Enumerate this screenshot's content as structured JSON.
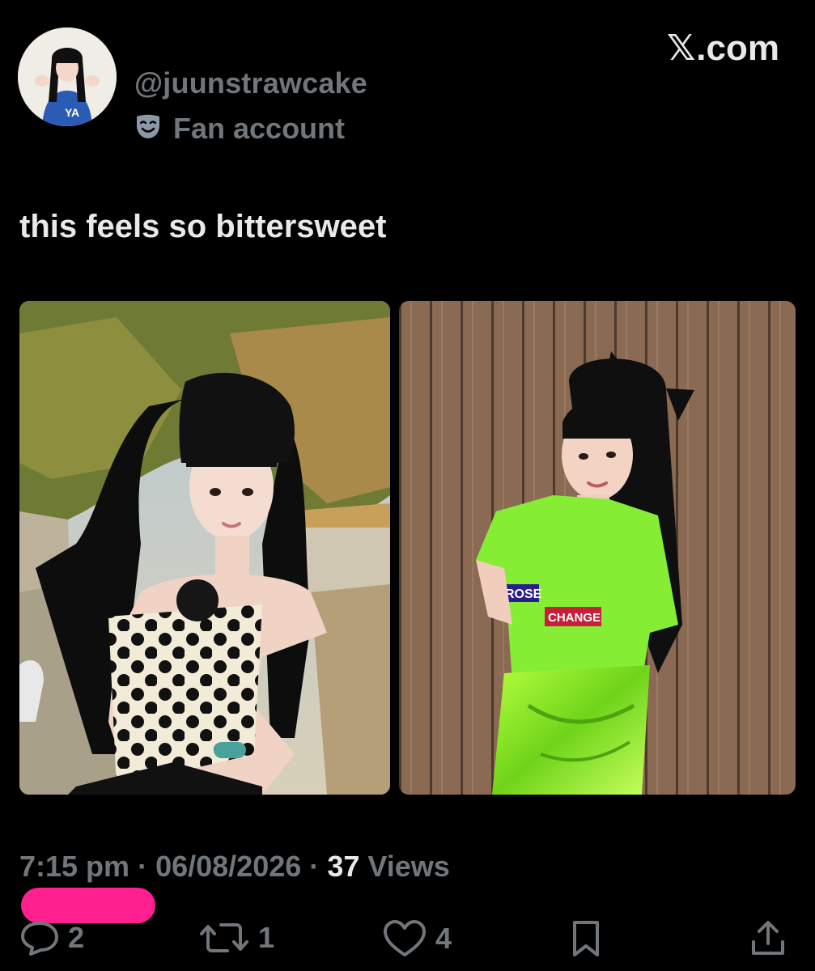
{
  "author": {
    "handle": "@juunstrawcake",
    "badge_label": "Fan account",
    "badge_icon": "theater-mask-icon"
  },
  "brand": {
    "glyph": "𝕏",
    "suffix": ".com"
  },
  "tweet": {
    "text": "this feels so bittersweet",
    "time": "7:15 pm",
    "date": "06/08/2026",
    "views_count": "37",
    "views_label": "Views",
    "separator": "·"
  },
  "actions": {
    "reply": {
      "icon": "reply-icon",
      "count": "2"
    },
    "retweet": {
      "icon": "retweet-icon",
      "count": "1"
    },
    "like": {
      "icon": "heart-icon",
      "count": "4"
    },
    "bookmark": {
      "icon": "bookmark-icon"
    },
    "share": {
      "icon": "share-icon"
    }
  },
  "colors": {
    "background": "#000000",
    "primary_text": "#e7e9ea",
    "secondary_text": "#71767b",
    "redaction": "#ff1f8e"
  }
}
